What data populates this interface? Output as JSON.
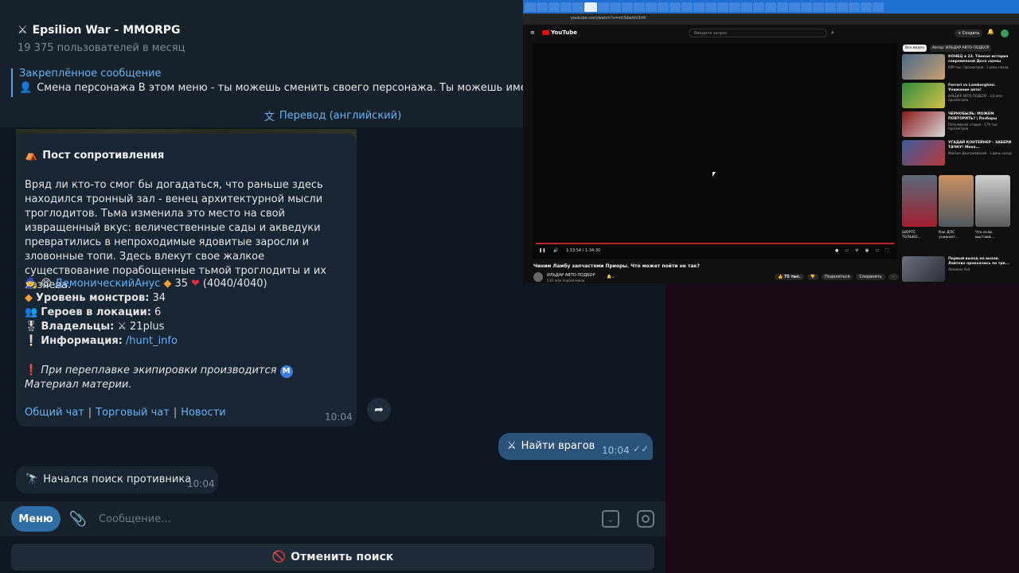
{
  "telegram": {
    "chat_title": "Epsilion War - MMORPG",
    "chat_subtitle": "19 375 пользователей в месяц",
    "pinned": {
      "title": "Закреплённое сообщение",
      "text": "Смена персонажа    В этом меню - ты можешь сменить своего персонажа. Ты можешь иметь до"
    },
    "translate_label": "Перевод (английский)",
    "post": {
      "title": "Пост сопротивления",
      "body": "Вряд ли кто-то смог бы догадаться, что раньше здесь находился тронный зал - венец архитектурной мысли троглодитов. Тьма изменила это место на свой извращенный вкус: величественные сады и акведуки превратились в непроходимые ядовитые заросли и зловонные топи. Здесь влекут свое жалкое существование порабощенные тьмой троглодиты и их хозяева.",
      "player_name": "ДемоническийАнус",
      "player_level": "35",
      "player_hp": "(4040/4040)",
      "monster_level_label": "Уровень монстров:",
      "monster_level": "34",
      "heroes_label": "Героев в локации:",
      "heroes": "6",
      "owners_label": "Владельцы:",
      "owners": "21plus",
      "info_label": "Информация:",
      "info_link": "/hunt_info",
      "note_a": "При переплавке экипировки производится",
      "note_b": "Материал материи.",
      "links": [
        "Общий чат",
        "Торговый чат",
        "Новости"
      ],
      "time": "10:04"
    },
    "outgoing": {
      "text": "Найти врагов",
      "time": "10:04"
    },
    "search_msg": {
      "text": "Начался поиск противника",
      "time": "10:04"
    },
    "composer": {
      "menu_label": "Меню",
      "placeholder": "Сообщение..."
    },
    "cancel_label": "Отменить поиск"
  },
  "browser": {
    "url": "youtube.com/watch?v=mt3dwhhi3tl4",
    "yt_logo": "YouTube",
    "search_placeholder": "Введите запрос",
    "create_label": "+ Создать",
    "player_time": "1:33:54 / 1:34:30",
    "video_title": "Чиним Ламбу запчастями Приоры. Что может пойти не так?",
    "channel": "ИЛЬДАР АВТО-ПОДБОР",
    "subs": "5,61 млн подписчиков",
    "actions": [
      "75 тыс.",
      "Поделиться",
      "Сохранить"
    ],
    "chips": [
      "Все видео",
      "Автор: ИЛЬДАР АВТО-ПОДБОР"
    ],
    "recommendations": [
      {
        "title": "КОНЕЦ в 23. Тёмная история современной Доса сцены",
        "meta": "609 тыс. просмотров · 1 день назад"
      },
      {
        "title": "Ferrari vs Lamborghini. Унижение авто!",
        "meta": "ИЛЬДАР АВТО-ПОДБОР · 3,6 млн просмотров"
      },
      {
        "title": "ЧЕРНОБЫЛЬ: МОЖЕМ ПОВТОРИТЬ? | Разборы",
        "meta": "Популярная стадия · 179 тыс. просмотров"
      },
      {
        "title": "УГАДАЙ КОНТЕЙНЕР - ЗАБЕРИ ТАЧКУ! Меня...",
        "meta": "Михаил Дмитриевский · 1 день назад"
      }
    ],
    "shorts": [
      "ШОРТС ТОЛЬКО...",
      "Как ДПС унижает...",
      "Что если выстави..."
    ],
    "bottom_rec": {
      "title": "Первый выезд на вызов. Лайтово проехались по тре...",
      "meta": "Ломакин 4х4"
    }
  }
}
